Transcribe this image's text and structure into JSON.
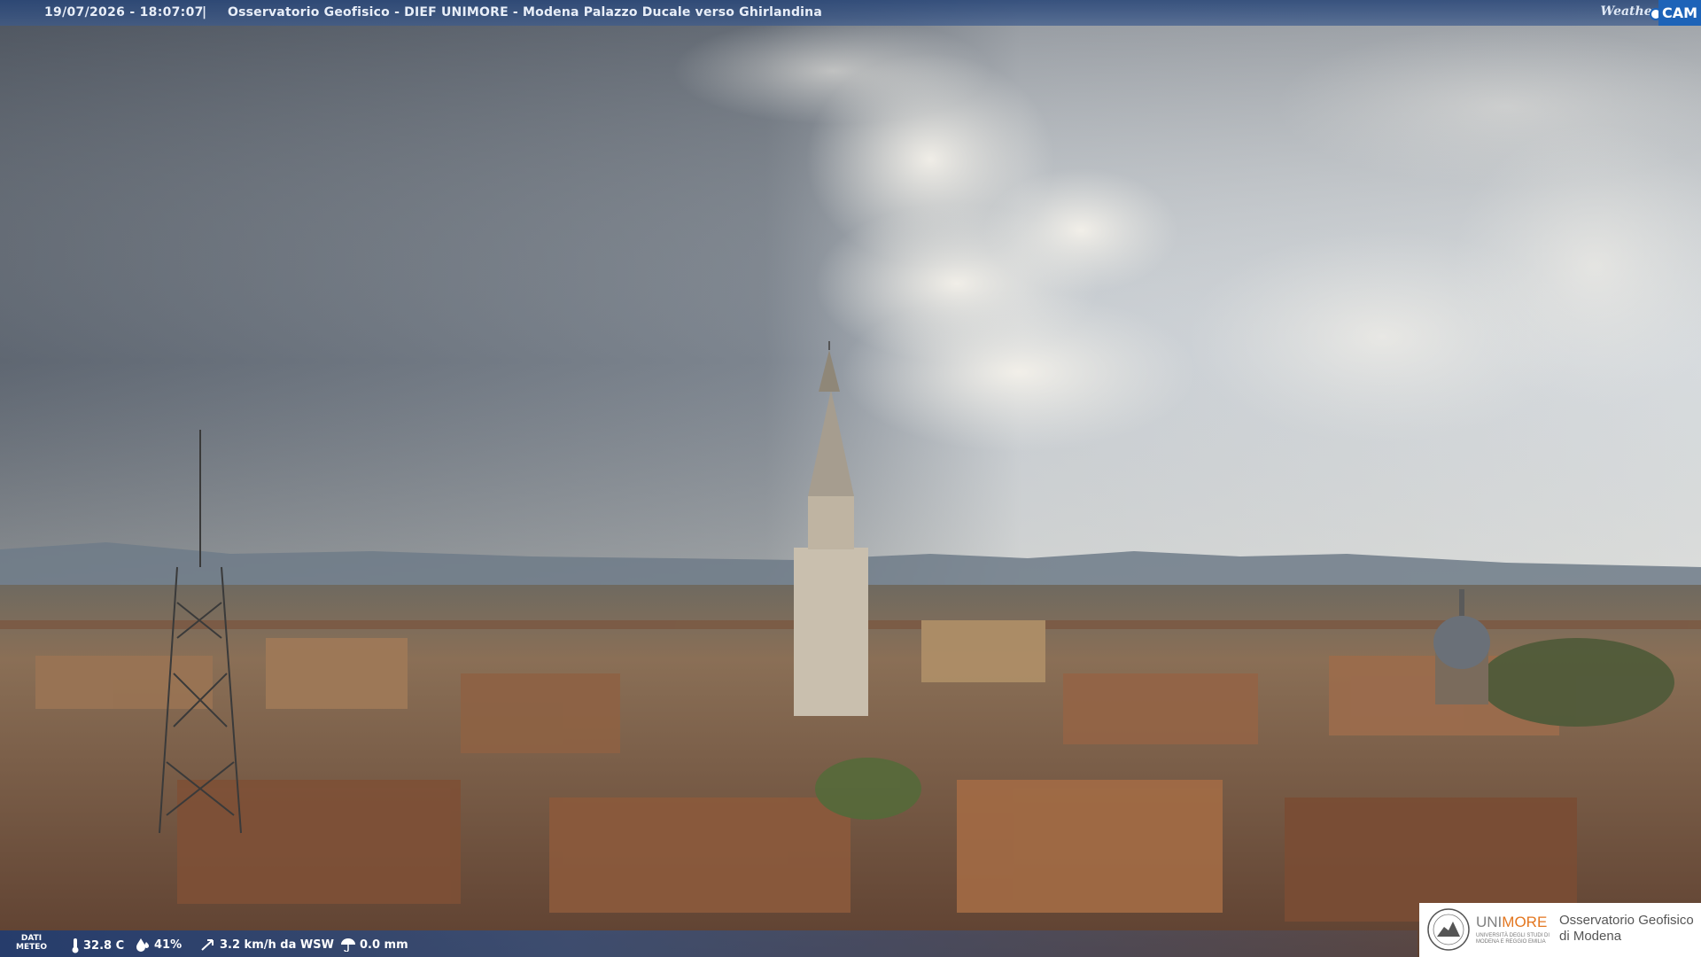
{
  "overlay": {
    "timestamp": "19/07/2026 - 18:07:07",
    "separator": "|",
    "title": "Osservatorio Geofisico - DIEF UNIMORE - Modena Palazzo Ducale verso Ghirlandina"
  },
  "brand": {
    "weather": "Weather",
    "cam": "CAM"
  },
  "meteo": {
    "label_line1": "DATI",
    "label_line2": "METEO",
    "temperature": "32.8 C",
    "humidity": "41%",
    "wind": "3.2 km/h da WSW",
    "rain": "0.0 mm"
  },
  "logo": {
    "uni_prefix": "UNI",
    "uni_suffix": "MORE",
    "uni_line1": "UNIVERSITÀ DEGLI STUDI DI",
    "uni_line2": "MODENA E REGGIO EMILIA",
    "obs_line1": "Osservatorio Geofisico",
    "obs_line2": "di Modena"
  },
  "colors": {
    "bar_blue": "#1d63b8",
    "unimore_orange": "#e3761f",
    "roof_terracotta": "#8a5a3c"
  }
}
